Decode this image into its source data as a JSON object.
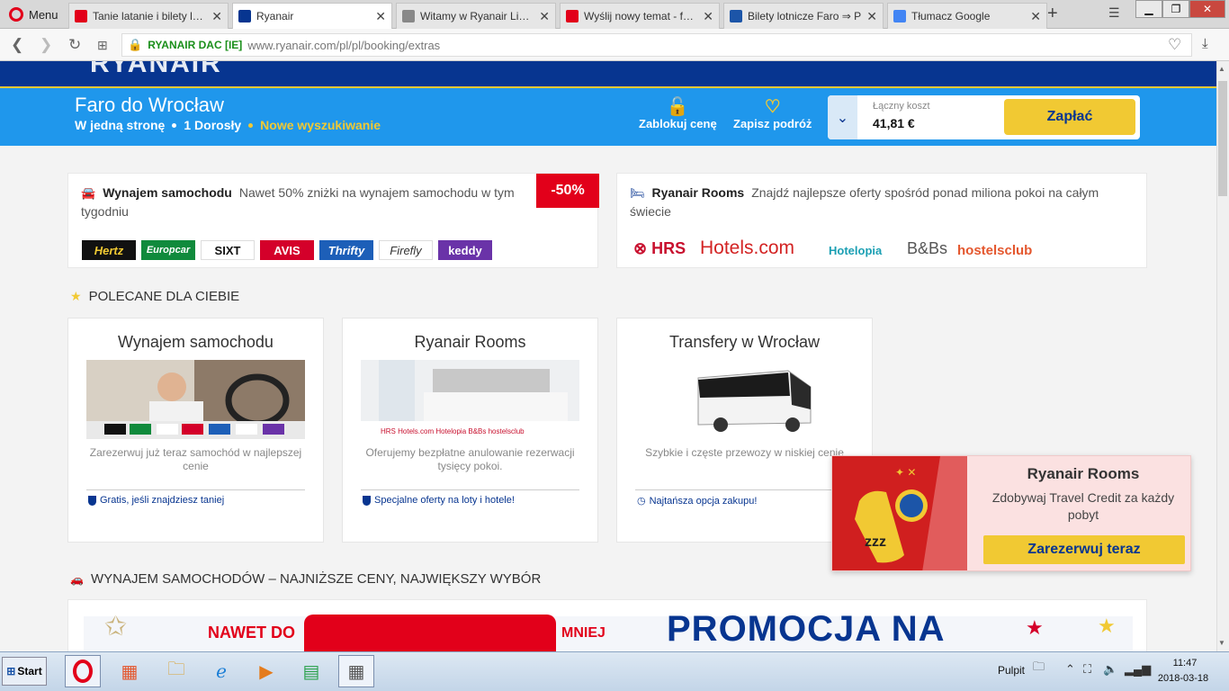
{
  "browser": {
    "menu_label": "Menu",
    "tabs": [
      {
        "title": "Tanie latanie i bilety lotnicze"
      },
      {
        "title": "Ryanair"
      },
      {
        "title": "Witamy w Ryanair Live Chat"
      },
      {
        "title": "Wyślij nowy temat - forum"
      },
      {
        "title": "Bilety lotnicze Faro ⇒ P"
      },
      {
        "title": "Tłumacz Google"
      }
    ],
    "new_tab": "+",
    "secure_label": "RYANAIR DAC [IE]",
    "url": "www.ryanair.com/pl/pl/booking/extras"
  },
  "header": {
    "logo": "RYANAIR",
    "route": "Faro do Wrocław",
    "trip_type": "W jedną stronę",
    "passengers": "1 Dorosły",
    "new_search": "Nowe wyszukiwanie",
    "lock_price": "Zablokuj cenę",
    "save_trip": "Zapisz podróż",
    "total_label": "Łączny koszt",
    "total_value": "41,81 €",
    "pay": "Zapłać"
  },
  "car_card": {
    "title": "Wynajem samochodu",
    "text": "Nawet 50% zniżki na wynajem samochodu w tym tygodniu",
    "badge": "-50%",
    "brands": [
      "Hertz",
      "Europcar",
      "SIXT",
      "AVIS",
      "Thrifty",
      "Firefly",
      "keddy"
    ]
  },
  "rooms_card": {
    "title": "Ryanair Rooms",
    "text": "Znajdź najlepsze oferty spośród ponad miliona pokoi na całym świecie",
    "brands": [
      "HRS",
      "Hotels.com",
      "Hotelopia",
      "B&Bs",
      "hostelsclub"
    ]
  },
  "recommended": {
    "title": "POLECANE DLA CIEBIE",
    "items": [
      {
        "title": "Wynajem samochodu",
        "desc": "Zarezerwuj już teraz samochód w najlepszej cenie",
        "feature": "Gratis, jeśli znajdziesz taniej"
      },
      {
        "title": "Ryanair Rooms",
        "desc": "Oferujemy bezpłatne anulowanie rezerwacji tysięcy pokoi.",
        "feature": "Specjalne oferty na loty i hotele!"
      },
      {
        "title": "Transfery w Wrocław",
        "desc": "Szybkie i częste przewozy w niskiej cenie",
        "feature": "Najtańsza opcja zakupu!"
      }
    ]
  },
  "popup": {
    "title": "Ryanair Rooms",
    "desc": "Zdobywaj Travel Credit za każdy pobyt",
    "button": "Zarezerwuj teraz"
  },
  "car_section": {
    "title": "WYNAJEM SAMOCHODÓW – NAJNIŻSZE CENY, NAJWIĘKSZY WYBÓR",
    "banner_left": "NAWET DO",
    "banner_mid": "MNIEJ",
    "banner_right": "PROMOCJA NA"
  },
  "taskbar": {
    "start": "Start",
    "desktop": "Pulpit",
    "time": "11:47",
    "date": "2018-03-18"
  },
  "colors": {
    "brand_blue": "#073590",
    "bar_blue": "#1f97ec",
    "yellow": "#f1c933",
    "red": "#e2001a"
  }
}
